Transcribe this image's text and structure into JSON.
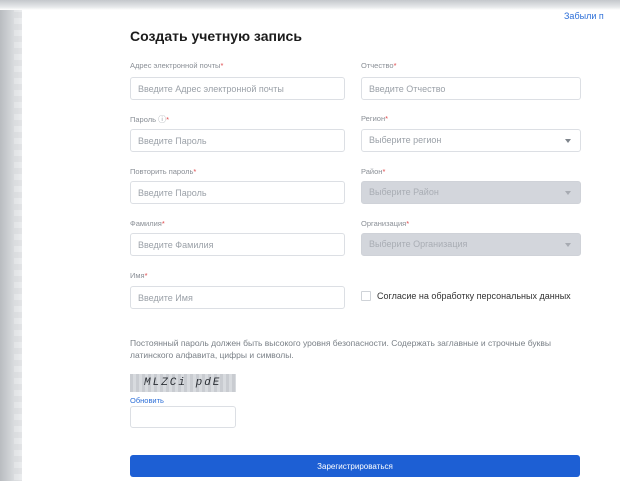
{
  "header": {
    "forgot_link": "Забыли п"
  },
  "form": {
    "title": "Создать учетную запись",
    "required_mark": "*",
    "email": {
      "label": "Адрес электронной почты",
      "placeholder": "Введите Адрес электронной почты"
    },
    "patronymic": {
      "label": "Отчество",
      "placeholder": "Введите Отчество"
    },
    "password": {
      "label": "Пароль",
      "help_glyph": "?",
      "placeholder": "Введите Пароль"
    },
    "region": {
      "label": "Регион",
      "value": "Выберите регион"
    },
    "repeat_password": {
      "label": "Повторить пароль",
      "placeholder": "Введите Пароль"
    },
    "district": {
      "label": "Район",
      "value": "Выберите Район",
      "disabled": true
    },
    "surname": {
      "label": "Фамилия",
      "placeholder": "Введите Фамилия"
    },
    "organization": {
      "label": "Организация",
      "value": "Выберите Организация",
      "disabled": true
    },
    "name": {
      "label": "Имя",
      "placeholder": "Введите Имя"
    },
    "consent": {
      "label": "Согласие на обработку персональных данных",
      "checked": false
    },
    "password_note": "Постоянный пароль должен быть высокого уровня безопасности. Содержать заглавные и строчные буквы латинского алфавита, цифры и символы.",
    "captcha": {
      "text": "MLZCi pdE",
      "refresh_label": "Обновить",
      "value": ""
    },
    "submit_label": "Зарегистрироваться"
  },
  "colors": {
    "accent": "#1d5fd4",
    "link": "#2d6fd8",
    "required": "#e0484b",
    "disabled_field": "#d3d6dc"
  }
}
